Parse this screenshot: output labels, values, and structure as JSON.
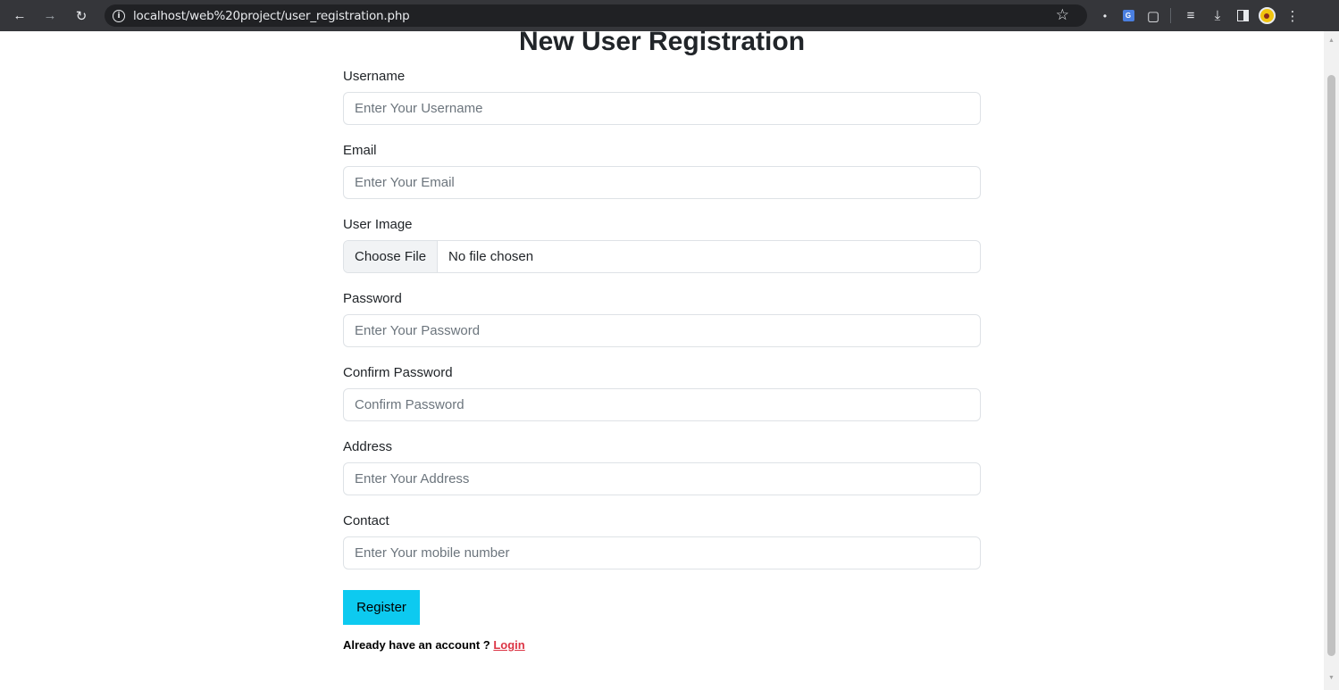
{
  "browser": {
    "url": "localhost/web%20project/user_registration.php",
    "icons": [
      "back-icon",
      "forward-icon",
      "reload-icon",
      "info-icon",
      "bookmark-star-icon",
      "extension-icon",
      "translate-extension-icon",
      "puzzle-extensions-icon",
      "reading-list-icon",
      "download-icon",
      "side-panel-icon",
      "profile-avatar-icon",
      "menu-kebab-icon"
    ]
  },
  "page": {
    "title": "New User Registration"
  },
  "form": {
    "username": {
      "label": "Username",
      "placeholder": "Enter Your Username"
    },
    "email": {
      "label": "Email",
      "placeholder": "Enter Your Email"
    },
    "user_image": {
      "label": "User Image",
      "button": "Choose File",
      "status": "No file chosen"
    },
    "password": {
      "label": "Password",
      "placeholder": "Enter Your Password"
    },
    "confirm_password": {
      "label": "Confirm Password",
      "placeholder": "Confirm Password"
    },
    "address": {
      "label": "Address",
      "placeholder": "Enter Your Address"
    },
    "contact": {
      "label": "Contact",
      "placeholder": "Enter Your mobile number"
    },
    "submit_label": "Register"
  },
  "footer": {
    "prompt": "Already have an account ? ",
    "login_label": "Login"
  },
  "colors": {
    "chrome_bg": "#35363a",
    "register_button": "#0dcaf0",
    "login_link": "#dc3545"
  }
}
